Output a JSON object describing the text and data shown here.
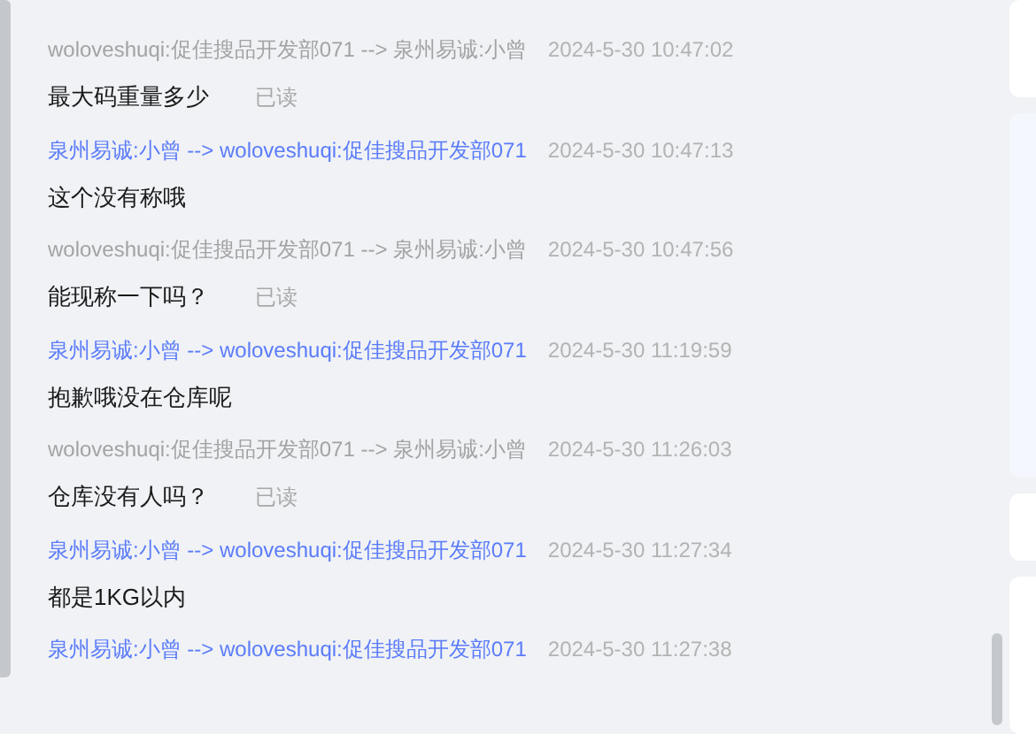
{
  "messages": [
    {
      "kind": "incoming",
      "header": "woloveshuqi:促佳搜品开发部071 --> 泉州易诚:小曾",
      "time": "2024-5-30 10:47:02",
      "text": "最大码重量多少",
      "status": "已读"
    },
    {
      "kind": "outgoing",
      "header": "泉州易诚:小曾 --> woloveshuqi:促佳搜品开发部071",
      "time": "2024-5-30 10:47:13",
      "text": "这个没有称哦"
    },
    {
      "kind": "incoming",
      "header": "woloveshuqi:促佳搜品开发部071 --> 泉州易诚:小曾",
      "time": "2024-5-30 10:47:56",
      "text": "能现称一下吗？",
      "status": "已读"
    },
    {
      "kind": "outgoing",
      "header": "泉州易诚:小曾 --> woloveshuqi:促佳搜品开发部071",
      "time": "2024-5-30 11:19:59",
      "text": "抱歉哦没在仓库呢"
    },
    {
      "kind": "incoming",
      "header": "woloveshuqi:促佳搜品开发部071 --> 泉州易诚:小曾",
      "time": "2024-5-30 11:26:03",
      "text": "仓库没有人吗？",
      "status": "已读"
    },
    {
      "kind": "outgoing",
      "header": "泉州易诚:小曾 --> woloveshuqi:促佳搜品开发部071",
      "time": "2024-5-30 11:27:34",
      "text": "都是1KG以内"
    },
    {
      "kind": "outgoing",
      "header": "泉州易诚:小曾 --> woloveshuqi:促佳搜品开发部071",
      "time": "2024-5-30 11:27:38"
    }
  ]
}
